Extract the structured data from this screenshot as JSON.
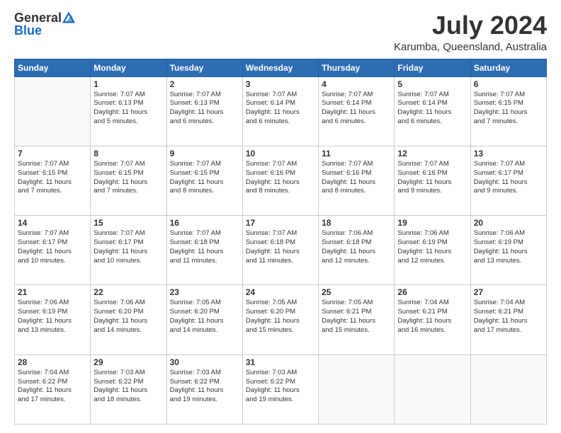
{
  "logo": {
    "text_general": "General",
    "text_blue": "Blue"
  },
  "header": {
    "month_year": "July 2024",
    "location": "Karumba, Queensland, Australia"
  },
  "days_of_week": [
    "Sunday",
    "Monday",
    "Tuesday",
    "Wednesday",
    "Thursday",
    "Friday",
    "Saturday"
  ],
  "weeks": [
    [
      {
        "day": "",
        "info": ""
      },
      {
        "day": "1",
        "info": "Sunrise: 7:07 AM\nSunset: 6:13 PM\nDaylight: 11 hours\nand 5 minutes."
      },
      {
        "day": "2",
        "info": "Sunrise: 7:07 AM\nSunset: 6:13 PM\nDaylight: 11 hours\nand 6 minutes."
      },
      {
        "day": "3",
        "info": "Sunrise: 7:07 AM\nSunset: 6:14 PM\nDaylight: 11 hours\nand 6 minutes."
      },
      {
        "day": "4",
        "info": "Sunrise: 7:07 AM\nSunset: 6:14 PM\nDaylight: 11 hours\nand 6 minutes."
      },
      {
        "day": "5",
        "info": "Sunrise: 7:07 AM\nSunset: 6:14 PM\nDaylight: 11 hours\nand 6 minutes."
      },
      {
        "day": "6",
        "info": "Sunrise: 7:07 AM\nSunset: 6:15 PM\nDaylight: 11 hours\nand 7 minutes."
      }
    ],
    [
      {
        "day": "7",
        "info": "Sunrise: 7:07 AM\nSunset: 6:15 PM\nDaylight: 11 hours\nand 7 minutes."
      },
      {
        "day": "8",
        "info": "Sunrise: 7:07 AM\nSunset: 6:15 PM\nDaylight: 11 hours\nand 7 minutes."
      },
      {
        "day": "9",
        "info": "Sunrise: 7:07 AM\nSunset: 6:15 PM\nDaylight: 11 hours\nand 8 minutes."
      },
      {
        "day": "10",
        "info": "Sunrise: 7:07 AM\nSunset: 6:16 PM\nDaylight: 11 hours\nand 8 minutes."
      },
      {
        "day": "11",
        "info": "Sunrise: 7:07 AM\nSunset: 6:16 PM\nDaylight: 11 hours\nand 8 minutes."
      },
      {
        "day": "12",
        "info": "Sunrise: 7:07 AM\nSunset: 6:16 PM\nDaylight: 11 hours\nand 9 minutes."
      },
      {
        "day": "13",
        "info": "Sunrise: 7:07 AM\nSunset: 6:17 PM\nDaylight: 11 hours\nand 9 minutes."
      }
    ],
    [
      {
        "day": "14",
        "info": "Sunrise: 7:07 AM\nSunset: 6:17 PM\nDaylight: 11 hours\nand 10 minutes."
      },
      {
        "day": "15",
        "info": "Sunrise: 7:07 AM\nSunset: 6:17 PM\nDaylight: 11 hours\nand 10 minutes."
      },
      {
        "day": "16",
        "info": "Sunrise: 7:07 AM\nSunset: 6:18 PM\nDaylight: 11 hours\nand 11 minutes."
      },
      {
        "day": "17",
        "info": "Sunrise: 7:07 AM\nSunset: 6:18 PM\nDaylight: 11 hours\nand 11 minutes."
      },
      {
        "day": "18",
        "info": "Sunrise: 7:06 AM\nSunset: 6:18 PM\nDaylight: 11 hours\nand 12 minutes."
      },
      {
        "day": "19",
        "info": "Sunrise: 7:06 AM\nSunset: 6:19 PM\nDaylight: 11 hours\nand 12 minutes."
      },
      {
        "day": "20",
        "info": "Sunrise: 7:06 AM\nSunset: 6:19 PM\nDaylight: 11 hours\nand 13 minutes."
      }
    ],
    [
      {
        "day": "21",
        "info": "Sunrise: 7:06 AM\nSunset: 6:19 PM\nDaylight: 11 hours\nand 13 minutes."
      },
      {
        "day": "22",
        "info": "Sunrise: 7:06 AM\nSunset: 6:20 PM\nDaylight: 11 hours\nand 14 minutes."
      },
      {
        "day": "23",
        "info": "Sunrise: 7:05 AM\nSunset: 6:20 PM\nDaylight: 11 hours\nand 14 minutes."
      },
      {
        "day": "24",
        "info": "Sunrise: 7:05 AM\nSunset: 6:20 PM\nDaylight: 11 hours\nand 15 minutes."
      },
      {
        "day": "25",
        "info": "Sunrise: 7:05 AM\nSunset: 6:21 PM\nDaylight: 11 hours\nand 15 minutes."
      },
      {
        "day": "26",
        "info": "Sunrise: 7:04 AM\nSunset: 6:21 PM\nDaylight: 11 hours\nand 16 minutes."
      },
      {
        "day": "27",
        "info": "Sunrise: 7:04 AM\nSunset: 6:21 PM\nDaylight: 11 hours\nand 17 minutes."
      }
    ],
    [
      {
        "day": "28",
        "info": "Sunrise: 7:04 AM\nSunset: 6:22 PM\nDaylight: 11 hours\nand 17 minutes."
      },
      {
        "day": "29",
        "info": "Sunrise: 7:03 AM\nSunset: 6:22 PM\nDaylight: 11 hours\nand 18 minutes."
      },
      {
        "day": "30",
        "info": "Sunrise: 7:03 AM\nSunset: 6:22 PM\nDaylight: 11 hours\nand 19 minutes."
      },
      {
        "day": "31",
        "info": "Sunrise: 7:03 AM\nSunset: 6:22 PM\nDaylight: 11 hours\nand 19 minutes."
      },
      {
        "day": "",
        "info": ""
      },
      {
        "day": "",
        "info": ""
      },
      {
        "day": "",
        "info": ""
      }
    ]
  ]
}
